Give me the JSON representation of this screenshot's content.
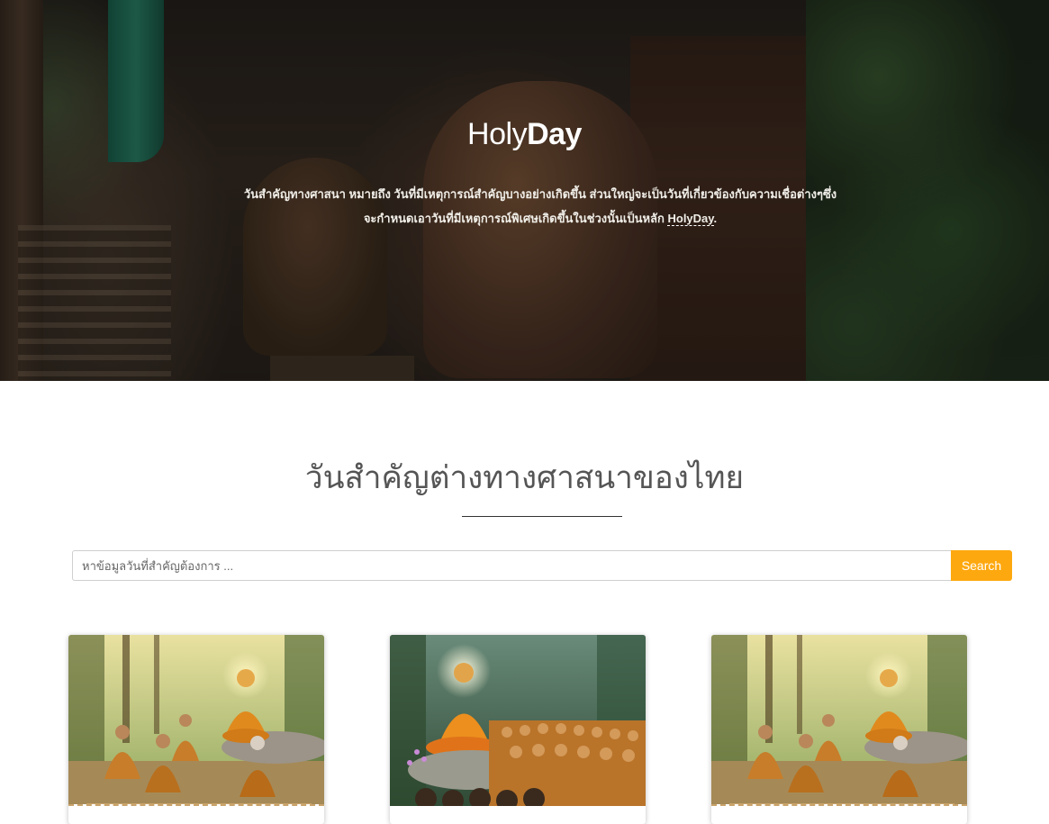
{
  "hero": {
    "title_light": "Holy",
    "title_bold": "Day",
    "description_line1": "วันสำคัญทางศาสนา หมายถึง วันที่มีเหตุการณ์สำคัญบางอย่างเกิดขึ้น ส่วนใหญ่จะเป็นวันที่เกี่ยวข้องกับความเชื่อต่างๆซึ่ง",
    "description_line2": "จะกำหนดเอาวันที่มีเหตุการณ์พิเศษเกิดขึ้นในช่วงนั้นเป็นหลัก",
    "description_highlight": "HolyDay",
    "description_end": "."
  },
  "section": {
    "title": "วันสำคัญต่างทางศาสนาของไทย"
  },
  "search": {
    "placeholder": "หาข้อมูลวันที่สำคัญต้องการ ...",
    "value": "",
    "button_label": "Search"
  },
  "cards": [
    {
      "image": "buddha-teaching-disciples-painting"
    },
    {
      "image": "buddha-with-assembled-monks-painting"
    },
    {
      "image": "buddha-teaching-disciples-painting"
    }
  ],
  "colors": {
    "accent": "#fea80f",
    "title_text": "#555555"
  }
}
